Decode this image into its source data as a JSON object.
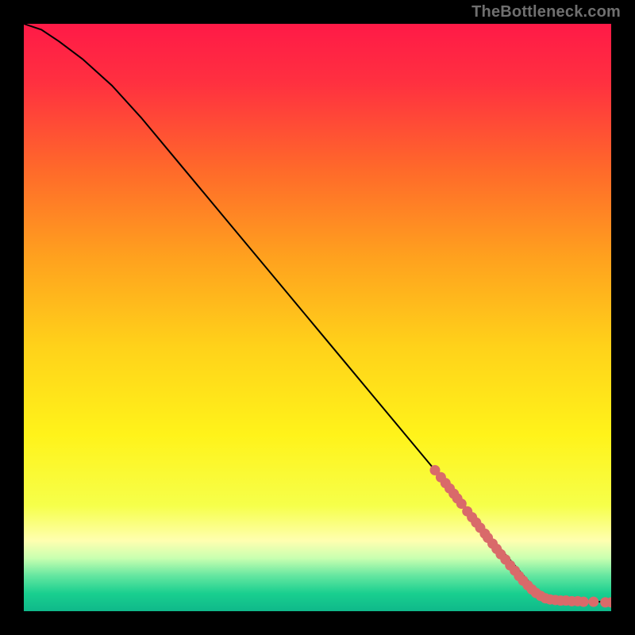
{
  "watermark": "TheBottleneck.com",
  "chart_data": {
    "type": "line",
    "title": "",
    "xlabel": "",
    "ylabel": "",
    "xlim": [
      0,
      100
    ],
    "ylim": [
      0,
      100
    ],
    "grid": false,
    "series": [
      {
        "name": "curve",
        "x": [
          0,
          3,
          6,
          10,
          15,
          20,
          25,
          30,
          35,
          40,
          45,
          50,
          55,
          60,
          65,
          70,
          75,
          80,
          83,
          86,
          88,
          90,
          92,
          94,
          96,
          98,
          100
        ],
        "y": [
          100,
          99,
          97,
          94,
          89.5,
          84,
          78,
          72,
          66,
          60,
          54,
          48,
          42,
          36,
          30,
          24,
          18,
          12,
          8.5,
          5,
          3,
          2,
          1.8,
          1.7,
          1.6,
          1.6,
          1.5
        ]
      }
    ],
    "scatter": [
      {
        "name": "dots",
        "points": [
          [
            70.0,
            24.0
          ],
          [
            71.0,
            22.8
          ],
          [
            71.8,
            21.8
          ],
          [
            72.5,
            20.9
          ],
          [
            73.2,
            20.0
          ],
          [
            73.8,
            19.2
          ],
          [
            74.5,
            18.3
          ],
          [
            75.5,
            17.0
          ],
          [
            76.3,
            16.0
          ],
          [
            77.0,
            15.1
          ],
          [
            77.7,
            14.2
          ],
          [
            78.5,
            13.2
          ],
          [
            79.0,
            12.5
          ],
          [
            79.8,
            11.5
          ],
          [
            80.5,
            10.6
          ],
          [
            81.2,
            9.7
          ],
          [
            82.0,
            8.8
          ],
          [
            82.8,
            7.8
          ],
          [
            83.6,
            6.9
          ],
          [
            84.3,
            6.0
          ],
          [
            85.0,
            5.2
          ],
          [
            85.8,
            4.4
          ],
          [
            86.5,
            3.7
          ],
          [
            87.2,
            3.1
          ],
          [
            88.0,
            2.6
          ],
          [
            88.8,
            2.2
          ],
          [
            89.6,
            2.0
          ],
          [
            90.5,
            1.9
          ],
          [
            91.4,
            1.8
          ],
          [
            92.3,
            1.8
          ],
          [
            93.3,
            1.7
          ],
          [
            94.3,
            1.7
          ],
          [
            95.3,
            1.6
          ],
          [
            97.0,
            1.6
          ],
          [
            99.0,
            1.5
          ],
          [
            100.0,
            1.5
          ]
        ]
      }
    ],
    "background_gradient": {
      "stops": [
        [
          0.0,
          "#ff1a47"
        ],
        [
          0.1,
          "#ff3040"
        ],
        [
          0.25,
          "#ff6a2a"
        ],
        [
          0.4,
          "#ffa21e"
        ],
        [
          0.55,
          "#ffd21a"
        ],
        [
          0.7,
          "#fff31a"
        ],
        [
          0.82,
          "#f6ff4a"
        ],
        [
          0.88,
          "#ffffb0"
        ],
        [
          0.91,
          "#c8ffb0"
        ],
        [
          0.94,
          "#63e6a0"
        ],
        [
          0.97,
          "#19cf8f"
        ],
        [
          1.0,
          "#0fb98a"
        ]
      ]
    },
    "dot_color": "#d96a6a",
    "curve_color": "#000000"
  }
}
